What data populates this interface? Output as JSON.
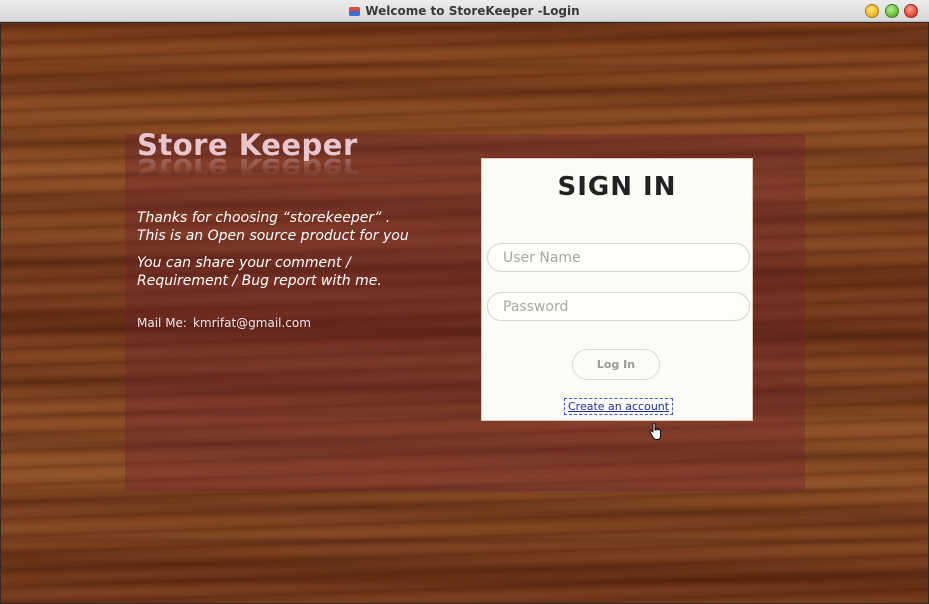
{
  "window": {
    "title": "Welcome to StoreKeeper -Login"
  },
  "brand": {
    "name": "Store Keeper"
  },
  "description": {
    "line1": "Thanks for choosing “storekeeper” .",
    "line2": "This is an Open source product for you",
    "line3": "You can share your comment /",
    "line4": "Requirement / Bug report with me."
  },
  "contact": {
    "label": "Mail Me:",
    "email": "kmrifat@gmail.com"
  },
  "login": {
    "title": "SIGN IN",
    "username_placeholder": "User Name",
    "username_value": "",
    "password_placeholder": "Password",
    "password_value": "",
    "login_label": "Log In",
    "create_account_label": "Create an account"
  },
  "colors": {
    "brand_text": "#e8c6cf",
    "panel_overlay": "#6e1e32",
    "link": "#1f2f9a"
  },
  "icons": [
    "app-icon",
    "minimize-icon",
    "maximize-icon",
    "close-icon",
    "hand-cursor-icon"
  ]
}
